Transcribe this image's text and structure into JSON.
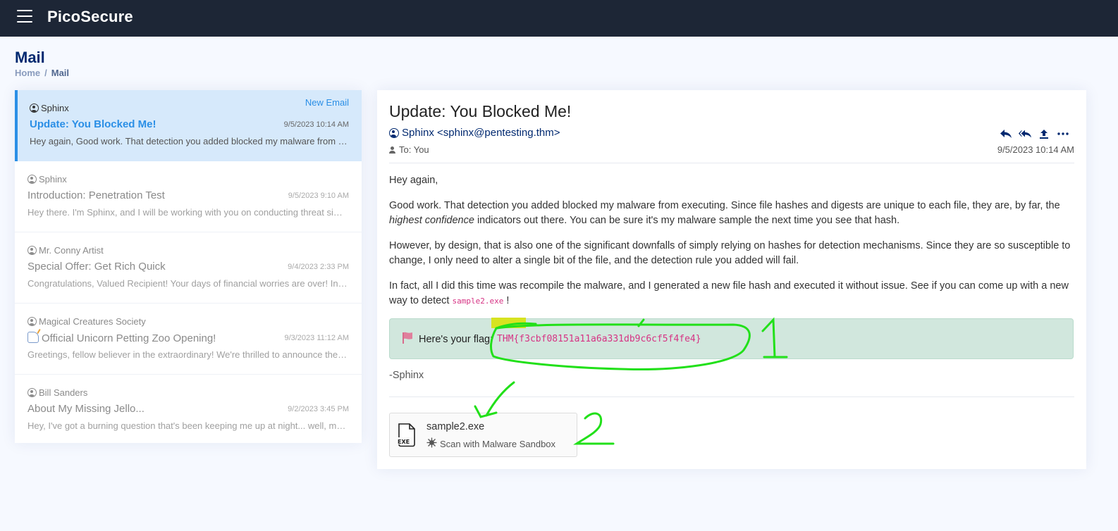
{
  "app": {
    "brand": "PicoSecure"
  },
  "page": {
    "title": "Mail",
    "breadcrumb": {
      "home": "Home",
      "separator": "/",
      "current": "Mail"
    }
  },
  "inbox": {
    "items": [
      {
        "sender": "Sphinx",
        "subject": "Update: You Blocked Me!",
        "date": "9/5/2023 10:14 AM",
        "preview": "Hey again, Good work. That detection you added blocked my malware from executing. Since file hashes and digests are unique to each file...",
        "badge": "New Email",
        "active": true
      },
      {
        "sender": "Sphinx",
        "subject": "Introduction: Penetration Test",
        "date": "9/5/2023 9:10 AM",
        "preview": "Hey there. I'm Sphinx, and I will be working with you on conducting threat simulation exercises..."
      },
      {
        "sender": "Mr. Conny Artist",
        "subject": "Special Offer: Get Rich Quick",
        "date": "9/4/2023 2:33 PM",
        "preview": "Congratulations, Valued Recipient! Your days of financial worries are over! Introducing..."
      },
      {
        "sender": "Magical Creatures Society",
        "subject": "Official Unicorn Petting Zoo Opening!",
        "date": "9/3/2023 11:12 AM",
        "preview": "Greetings, fellow believer in the extraordinary! We're thrilled to announce the grand opening..."
      },
      {
        "sender": "Bill Sanders",
        "subject": "About My Missing Jello...",
        "date": "9/2/2023 3:45 PM",
        "preview": "Hey, I've got a burning question that's been keeping me up at night... well, more like..."
      }
    ]
  },
  "message": {
    "subject": "Update: You Blocked Me!",
    "from": "Sphinx <sphinx@pentesting.thm>",
    "to": "To: You",
    "date": "9/5/2023 10:14 AM",
    "body": {
      "greeting": "Hey again,",
      "p1_a": "Good work. That detection you added blocked my malware from executing. Since file hashes and digests are unique to each file, they are, by far, the ",
      "p1_em": "highest confidence",
      "p1_b": " indicators out there. You can be sure it's my malware sample the next time you see that hash.",
      "p2": "However, by design, that is also one of the significant downfalls of simply relying on hashes for detection mechanisms. Since they are so susceptible to change, I only need to alter a single bit of the file, and the detection rule you added will fail.",
      "p3_a": "In fact, all I did this time was recompile the malware, and I generated a new file hash and executed it without issue. See if you can come up with a new way to detect ",
      "p3_code": "sample2.exe",
      "p3_b": " !"
    },
    "flag": {
      "label": "Here's your flag:",
      "value": "THM{f3cbf08151a11a6a331db9c6cf5f4fe4}"
    },
    "signature": "-Sphinx",
    "attachment": {
      "name": "sample2.exe",
      "file_type": "EXE",
      "action": "Scan with Malware Sandbox"
    }
  },
  "annotations": {
    "mark_1": "1",
    "mark_2": "2",
    "color": "#22e01a"
  },
  "colors": {
    "accent": "#2b8fe6",
    "navy": "#012970",
    "topbar": "#1d2636",
    "flag_bg": "#d1e7dd",
    "code": "#d63384"
  },
  "icons": {
    "menu": "hamburger-icon",
    "user": "user-circle-icon",
    "flag": "flag-icon",
    "reply": "reply-icon",
    "reply_all": "reply-all-icon",
    "forward": "upload-icon",
    "more": "more-horizontal-icon",
    "file": "exe-file-icon",
    "scan": "virus-icon"
  }
}
